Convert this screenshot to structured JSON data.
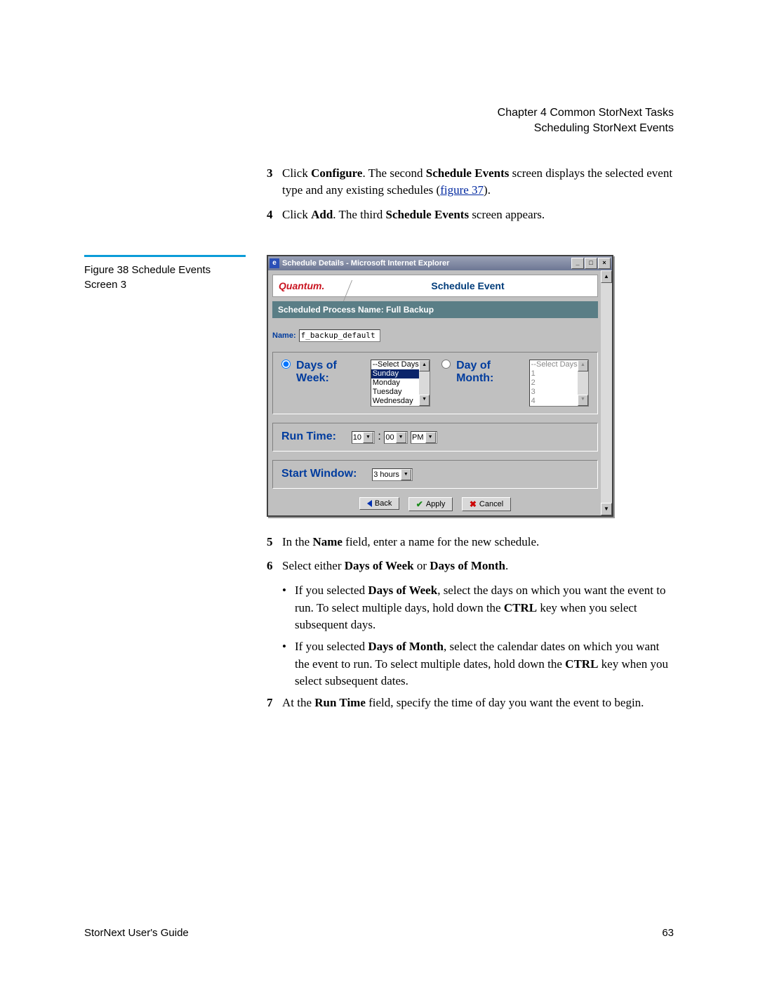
{
  "header": {
    "chapter_line": "Chapter 4  Common StorNext Tasks",
    "section_line": "Scheduling StorNext Events"
  },
  "steps_top": {
    "s3": {
      "num": "3",
      "pre": "Click ",
      "bold1": "Configure",
      "mid": ". The second ",
      "bold2": "Schedule Events",
      "post": " screen displays the selected event type and any existing schedules (",
      "link": "figure 37",
      "end": ")."
    },
    "s4": {
      "num": "4",
      "pre": "Click ",
      "bold1": "Add",
      "mid": ". The third ",
      "bold2": "Schedule Events",
      "post": " screen appears."
    }
  },
  "figure_caption": {
    "line1": "Figure 38  Schedule Events",
    "line2": "Screen 3"
  },
  "screenshot": {
    "window_title": "Schedule Details - Microsoft Internet Explorer",
    "logo": "Quantum.",
    "panel_title": "Schedule Event",
    "process_label": "Scheduled Process Name: Full Backup",
    "name_label": "Name:",
    "name_value": "f_backup_default",
    "dow_label": "Days of Week:",
    "dom_label": "Day of Month:",
    "dow_items": [
      "--Select Days--",
      "Sunday",
      "Monday",
      "Tuesday",
      "Wednesday"
    ],
    "dom_items": [
      "--Select Days--",
      "1",
      "2",
      "3",
      "4"
    ],
    "runtime_label": "Run Time:",
    "runtime_hour": "10",
    "runtime_sep": ":",
    "runtime_min": "00",
    "runtime_ampm": "PM",
    "startwin_label": "Start Window:",
    "startwin_value": "3 hours",
    "btn_back": "Back",
    "btn_apply": "Apply",
    "btn_cancel": "Cancel"
  },
  "steps_bottom": {
    "s5": {
      "num": "5",
      "pre": "In the ",
      "bold1": "Name",
      "post": " field, enter a name for the new schedule."
    },
    "s6": {
      "num": "6",
      "pre": "Select either ",
      "bold1": "Days of Week",
      "mid": " or ",
      "bold2": "Days of Month",
      "post": "."
    },
    "b1": {
      "pre": "If you selected ",
      "bold1": "Days of Week",
      "mid": ", select the days on which you want the event to run. To select multiple days, hold down the ",
      "bold2": "CTRL",
      "post": " key when you select subsequent days."
    },
    "b2": {
      "pre": "If you selected ",
      "bold1": "Days of Month",
      "mid": ", select the calendar dates on which you want the event to run. To select multiple dates, hold down the ",
      "bold2": "CTRL",
      "post": " key when you select subsequent dates."
    },
    "s7": {
      "num": "7",
      "pre": "At the ",
      "bold1": "Run Time",
      "post": " field, specify the time of day you want the event to begin."
    }
  },
  "footer": {
    "guide": "StorNext User's Guide",
    "page": "63"
  }
}
